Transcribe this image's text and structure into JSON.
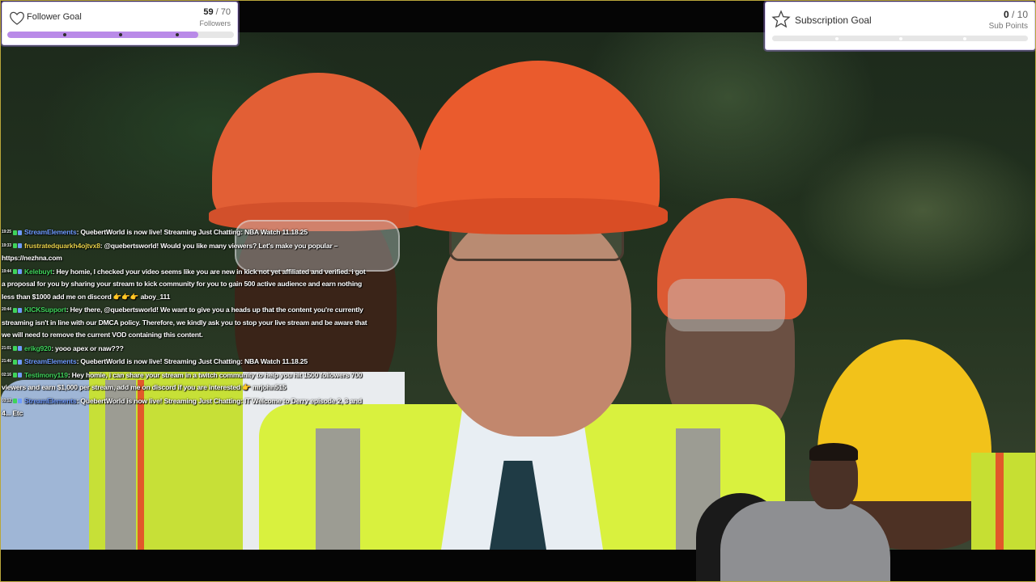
{
  "follower_goal": {
    "title": "Follower Goal",
    "current": "59",
    "separator": " / ",
    "target": "70",
    "unit": "Followers",
    "progress": 0.843,
    "bar_color": "#b98ae8",
    "icon": "heart-outline-icon"
  },
  "subscription_goal": {
    "title": "Subscription Goal",
    "current": "0",
    "separator": " / ",
    "target": "10",
    "unit": "Sub Points",
    "progress": 0.0,
    "icon": "star-outline-icon"
  },
  "chat": {
    "messages": [
      {
        "time": "19:25",
        "user": "StreamElements",
        "user_color": "#6f9bff",
        "text": ": QuebertWorld is now live! Streaming Just Chatting: NBA Watch 11.18.25"
      },
      {
        "time": "19:33",
        "user": "frustratedquarkh4ojtvx8",
        "user_color": "#e8d24a",
        "text": ": @quebertsworld! Would you like many viewers? Let's make you popular – https://nezhna.com"
      },
      {
        "time": "19:44",
        "user": "Kelebuyt",
        "user_color": "#3fd35b",
        "text": ": Hey homie, I checked your video seems like you are new in kick not yet affiliated and verified. i got a proposal for you by sharing your stream to kick community for you to gain 500 active audience and earn nothing less than $1000 add me on discord 👉👉👉 aboy_111"
      },
      {
        "time": "20:44",
        "user": "KICKSupport",
        "user_color": "#3fd35b",
        "text": ": Hey there, @quebertsworld! We want to give you a heads up that the content you're currently streaming isn't in line with our DMCA policy. Therefore, we kindly ask you to stop your live stream and be aware that we will need to remove the current VOD containing this content."
      },
      {
        "time": "21:01",
        "user": "erikg920",
        "user_color": "#3fd35b",
        "text": ": yooo apex or naw???"
      },
      {
        "time": "21:40",
        "user": "StreamElements",
        "user_color": "#6f9bff",
        "text": ": QuebertWorld is now live! Streaming Just Chatting: NBA Watch 11.18.25"
      },
      {
        "time": "02:16",
        "user": "Testimony119",
        "user_color": "#3fd35b",
        "text": ": Hey homie, i can share your stream in a twitch community to help you hit 1500 followers 700 viewers and earn $1,000 per stream, add me on discord if you are interested 👉 mrjohn515"
      },
      {
        "time": "03:12",
        "user": "StreamElements",
        "user_color": "#6f9bff",
        "text": ": QuebertWorld is now live! Streaming Just Chatting: IT Welcome to Derry episode 2, 3 and 4... Etc"
      }
    ]
  },
  "colors": {
    "helmet_orange": "#e5572a",
    "helmet_yellow": "#f2c21a",
    "vest_green": "#d6f03a"
  }
}
